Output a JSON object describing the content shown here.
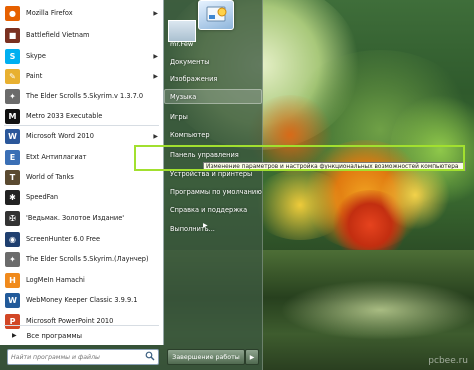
{
  "programs": [
    {
      "label": "Mozilla Firefox",
      "icon": "firefox-icon",
      "color": "#e66000",
      "glyph": "●",
      "has_submenu": true
    },
    {
      "label": "Battlefield Vietnam",
      "icon": "battlefield-icon",
      "color": "#7a3020",
      "glyph": "■",
      "has_submenu": false
    },
    {
      "label": "Skype",
      "icon": "skype-icon",
      "color": "#00aff0",
      "glyph": "S",
      "has_submenu": true
    },
    {
      "label": "Paint",
      "icon": "paint-icon",
      "color": "#e8b030",
      "glyph": "✎",
      "has_submenu": true
    },
    {
      "label": "The Elder Scrolls 5.Skyrim.v 1.3.7.0",
      "icon": "skyrim-icon",
      "color": "#6b6b6b",
      "glyph": "✦",
      "has_submenu": false
    },
    {
      "label": "Metro 2033 Executable",
      "icon": "metro-icon",
      "color": "#111111",
      "glyph": "M",
      "has_submenu": false
    },
    {
      "label": "Microsoft Word 2010",
      "icon": "word-icon",
      "color": "#2b579a",
      "glyph": "W",
      "has_submenu": true
    },
    {
      "label": "Etxt Антиплагиат",
      "icon": "etxt-icon",
      "color": "#3a6fb5",
      "glyph": "E",
      "has_submenu": false
    },
    {
      "label": "World of Tanks",
      "icon": "tanks-icon",
      "color": "#5a4a30",
      "glyph": "T",
      "has_submenu": false
    },
    {
      "label": "SpeedFan",
      "icon": "speedfan-icon",
      "color": "#222222",
      "glyph": "✱",
      "has_submenu": false
    },
    {
      "label": "'Ведьмак. Золотое Издание'",
      "icon": "witcher-icon",
      "color": "#333333",
      "glyph": "✠",
      "has_submenu": false
    },
    {
      "label": "ScreenHunter 6.0 Free",
      "icon": "screenhunter-icon",
      "color": "#1f3f6f",
      "glyph": "◉",
      "has_submenu": false
    },
    {
      "label": "The Elder Scrolls 5.Skyrim.(Лаунчер)",
      "icon": "skyrim-launcher-icon",
      "color": "#6b6b6b",
      "glyph": "✦",
      "has_submenu": false
    },
    {
      "label": "LogMeIn Hamachi",
      "icon": "hamachi-icon",
      "color": "#f08a1c",
      "glyph": "H",
      "has_submenu": false
    },
    {
      "label": "WebMoney Keeper Classic 3.9.9.1",
      "icon": "webmoney-icon",
      "color": "#225a9a",
      "glyph": "W",
      "has_submenu": false
    },
    {
      "label": "Microsoft PowerPoint 2010",
      "icon": "powerpoint-icon",
      "color": "#d24726",
      "glyph": "P",
      "has_submenu": false
    }
  ],
  "all_programs": "Все программы",
  "search_placeholder": "Найти программы и файлы",
  "username": "mr.Few",
  "right_items": [
    "Документы",
    "Изображения",
    "Музыка",
    "Игры",
    "Компьютер",
    "Панель управления",
    "Устройства и принтеры",
    "Программы по умолчанию",
    "Справка и поддержка",
    "Выполнить..."
  ],
  "tooltip": "Изменение параметров и настройка функциональных возможностей компьютера",
  "shutdown_label": "Завершение работы",
  "watermark": "pcbee.ru",
  "colors": {
    "highlight_box": "#a2e02f"
  }
}
